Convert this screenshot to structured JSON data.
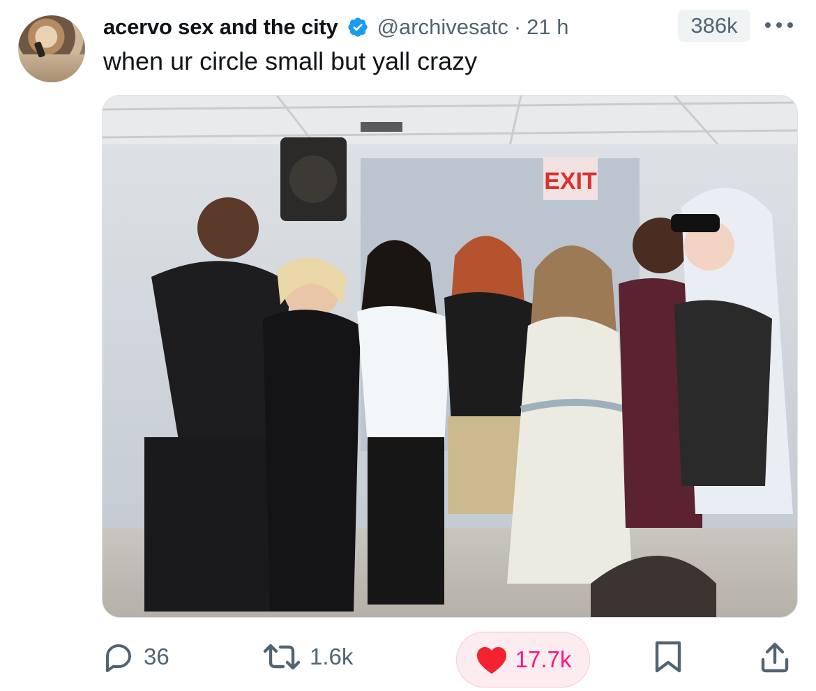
{
  "author": {
    "display_name": "acervo sex and the city",
    "handle": "@archivesatc",
    "separator": "·",
    "time": "21 h",
    "verified": true
  },
  "views_badge": "386k",
  "tweet_text": "when ur circle small but yall crazy",
  "media": {
    "sign_text": "EXIT"
  },
  "actions": {
    "replies": "36",
    "reposts": "1.6k",
    "likes": "17.7k",
    "liked": true
  },
  "colors": {
    "text_primary": "#0f1419",
    "text_secondary": "#536471",
    "verified_blue": "#1d9bf0",
    "like_pink": "#f91880",
    "heart_red": "#f4212e",
    "like_pill_bg": "#fdecef"
  },
  "icons": [
    "verified-badge-icon",
    "more-icon",
    "reply-icon",
    "repost-icon",
    "heart-icon",
    "bookmark-icon",
    "share-icon"
  ]
}
